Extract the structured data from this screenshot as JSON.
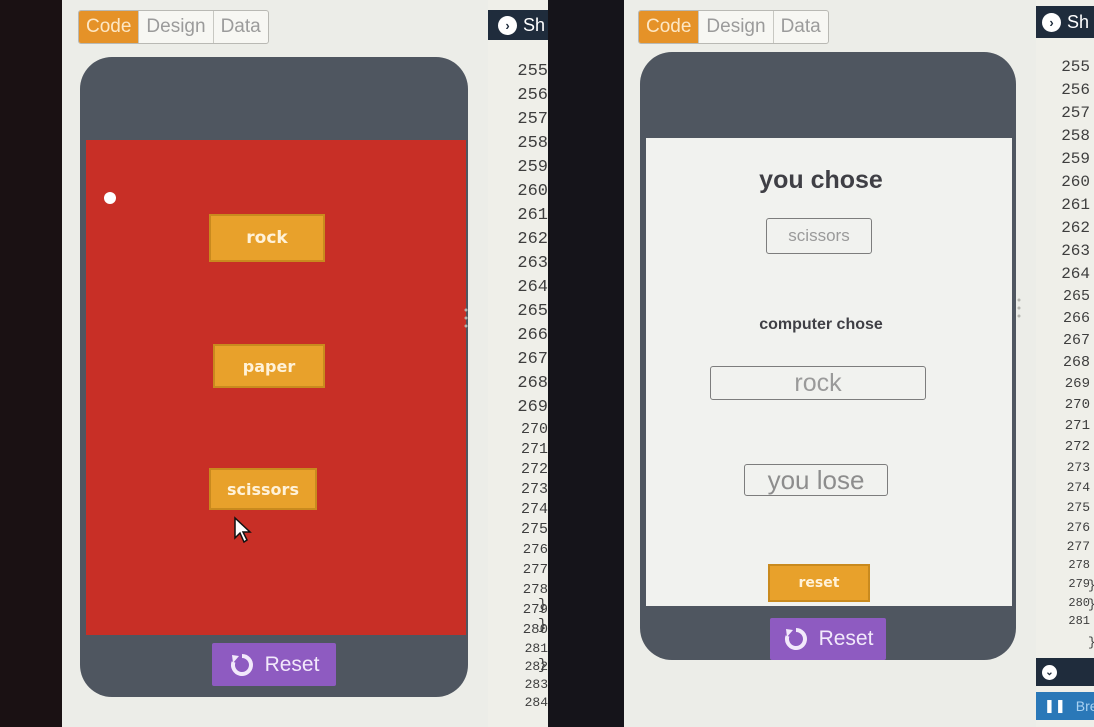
{
  "left_photo": {
    "tabs": [
      "Code",
      "Design",
      "Data"
    ],
    "active_tab": "Code",
    "show_button": "Sh",
    "app": {
      "background": "#c82f26",
      "buttons": {
        "rock": "rock",
        "paper": "paper",
        "scissors": "scissors"
      }
    },
    "reset_label": "Reset",
    "line_numbers": [
      "255",
      "256",
      "257",
      "258",
      "259",
      "260",
      "261",
      "262",
      "263",
      "264",
      "265",
      "266",
      "267",
      "268",
      "269",
      "270",
      "271",
      "272",
      "273",
      "274",
      "275",
      "276",
      "277",
      "278",
      "279",
      "280",
      "281",
      "282",
      "283",
      "284"
    ],
    "braces": {
      "278": "}",
      "279": "};",
      "281": "});"
    }
  },
  "right_photo": {
    "tabs": [
      "Code",
      "Design",
      "Data"
    ],
    "active_tab": "Code",
    "show_button": "Sh",
    "app": {
      "you_chose_label": "you chose",
      "you_chose_value": "scissors",
      "computer_chose_label": "computer chose",
      "computer_chose_value": "rock",
      "result": "you lose",
      "reset_app_button": "reset"
    },
    "reset_label": "Reset",
    "line_numbers": [
      "255",
      "256",
      "257",
      "258",
      "259",
      "260",
      "261",
      "262",
      "263",
      "264",
      "265",
      "266",
      "267",
      "268",
      "269",
      "270",
      "271",
      "272",
      "273",
      "274",
      "275",
      "276",
      "277",
      "278",
      "279",
      "280",
      "281"
    ],
    "braces": {
      "278": "}",
      "279": "}",
      "281": "}"
    },
    "bottom_bar": {
      "button_label": "Bre"
    }
  },
  "colors": {
    "tab_active": "#e59228",
    "app_button": "#e8a12b",
    "reset_button": "#8e5bc1",
    "phone_frame": "#4f5660",
    "header_bar": "#1f2c3c"
  }
}
